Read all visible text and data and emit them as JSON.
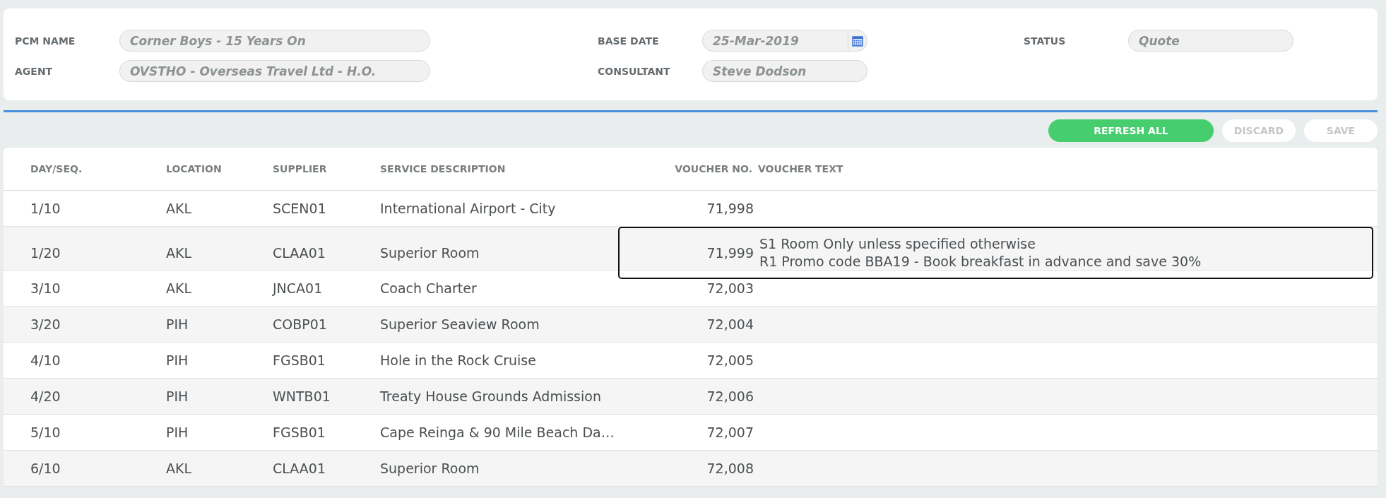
{
  "header": {
    "columns": [
      [
        {
          "label": "PCM NAME",
          "value": "Corner Boys - 15 Years On",
          "kind": "text"
        },
        {
          "label": "AGENT",
          "value": "OVSTHO - Overseas Travel Ltd - H.O.",
          "kind": "text"
        }
      ],
      [
        {
          "label": "BASE DATE",
          "value": "25-Mar-2019",
          "kind": "date"
        },
        {
          "label": "CONSULTANT",
          "value": "Steve Dodson",
          "kind": "text"
        }
      ],
      [
        {
          "label": "STATUS",
          "value": "Quote",
          "kind": "text"
        }
      ]
    ]
  },
  "toolbar": {
    "buttons": [
      {
        "label": "REFRESH ALL",
        "disabled": false
      },
      {
        "label": "DISCARD",
        "disabled": true
      },
      {
        "label": "SAVE",
        "disabled": true
      }
    ]
  },
  "table": {
    "columns": [
      "DAY/SEQ.",
      "LOCATION",
      "SUPPLIER",
      "SERVICE DESCRIPTION",
      "VOUCHER NO.",
      "VOUCHER TEXT"
    ],
    "rows": [
      {
        "day_seq": "1/10",
        "location": "AKL",
        "supplier": "SCEN01",
        "service": "International Airport - City",
        "voucher_no": "71,998",
        "focused": false
      },
      {
        "day_seq": "1/20",
        "location": "AKL",
        "supplier": "CLAA01",
        "service": "Superior Room",
        "voucher_no": "71,999",
        "voucher_text": [
          "S1 Room Only unless specified otherwise",
          "R1 Promo code BBA19 - Book breakfast in advance and save 30%"
        ],
        "focused": true
      },
      {
        "day_seq": "3/10",
        "location": "AKL",
        "supplier": "JNCA01",
        "service": "Coach Charter",
        "voucher_no": "72,003",
        "focused": false
      },
      {
        "day_seq": "3/20",
        "location": "PIH",
        "supplier": "COBP01",
        "service": "Superior Seaview Room",
        "voucher_no": "72,004",
        "focused": false
      },
      {
        "day_seq": "4/10",
        "location": "PIH",
        "supplier": "FGSB01",
        "service": "Hole in the Rock Cruise",
        "voucher_no": "72,005",
        "focused": false
      },
      {
        "day_seq": "4/20",
        "location": "PIH",
        "supplier": "WNTB01",
        "service": "Treaty House Grounds Admission",
        "voucher_no": "72,006",
        "focused": false
      },
      {
        "day_seq": "5/10",
        "location": "PIH",
        "supplier": "FGSB01",
        "service": "Cape Reinga & 90 Mile Beach Da…",
        "voucher_no": "72,007",
        "focused": false
      },
      {
        "day_seq": "6/10",
        "location": "AKL",
        "supplier": "CLAA01",
        "service": "Superior Room",
        "voucher_no": "72,008",
        "focused": false
      }
    ]
  }
}
